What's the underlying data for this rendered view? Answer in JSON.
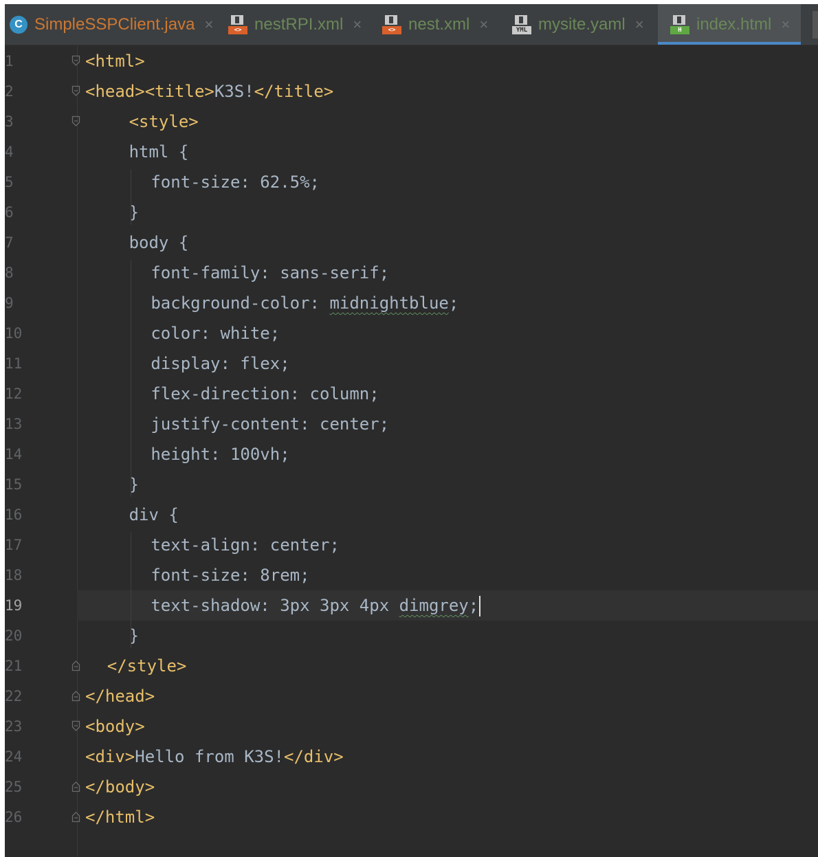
{
  "colors": {
    "editor_bg": "#2b2b2b",
    "tag": "#e8bf6a",
    "code_text": "#a9b7c6",
    "tab_label": "#6a8759",
    "active_tab_underline": "#4a88c7",
    "line_number": "#606366"
  },
  "tabs": [
    {
      "label": "SimpleSSPClient.java",
      "icon": "java-class-icon",
      "color": "#cc7832",
      "active": false
    },
    {
      "label": "nestRPI.xml",
      "icon": "xml-file-icon",
      "color": "#6a8759",
      "active": false
    },
    {
      "label": "nest.xml",
      "icon": "xml-file-icon",
      "color": "#6a8759",
      "active": false
    },
    {
      "label": "mysite.yaml",
      "icon": "yaml-file-icon",
      "color": "#6a8759",
      "active": false
    },
    {
      "label": "index.html",
      "icon": "html-file-icon",
      "color": "#6a8759",
      "active": true
    }
  ],
  "tab_close_glyph": "×",
  "editor": {
    "current_line": 19,
    "lines": [
      {
        "n": "1",
        "text": "<html>"
      },
      {
        "n": "2",
        "text": "<head><title>K3S!</title>"
      },
      {
        "n": "3",
        "text": "<style>"
      },
      {
        "n": "4",
        "text": "html {"
      },
      {
        "n": "5",
        "text": "font-size: 62.5%;"
      },
      {
        "n": "6",
        "text": "}"
      },
      {
        "n": "7",
        "text": "body {"
      },
      {
        "n": "8",
        "text": "font-family: sans-serif;"
      },
      {
        "n": "9",
        "text": "background-color: midnightblue;"
      },
      {
        "n": "10",
        "text": "color: white;"
      },
      {
        "n": "11",
        "text": "display: flex;"
      },
      {
        "n": "12",
        "text": "flex-direction: column;"
      },
      {
        "n": "13",
        "text": "justify-content: center;"
      },
      {
        "n": "14",
        "text": "height: 100vh;"
      },
      {
        "n": "15",
        "text": "}"
      },
      {
        "n": "16",
        "text": "div {"
      },
      {
        "n": "17",
        "text": "text-align: center;"
      },
      {
        "n": "18",
        "text": "font-size: 8rem;"
      },
      {
        "n": "19",
        "text": "text-shadow: 3px 3px 4px dimgrey;"
      },
      {
        "n": "20",
        "text": "}"
      },
      {
        "n": "21",
        "text": "</style>"
      },
      {
        "n": "22",
        "text": "</head>"
      },
      {
        "n": "23",
        "text": "<body>"
      },
      {
        "n": "24",
        "text": "<div>Hello from K3S!</div>"
      },
      {
        "n": "25",
        "text": "</body>"
      },
      {
        "n": "26",
        "text": "</html>"
      }
    ]
  }
}
